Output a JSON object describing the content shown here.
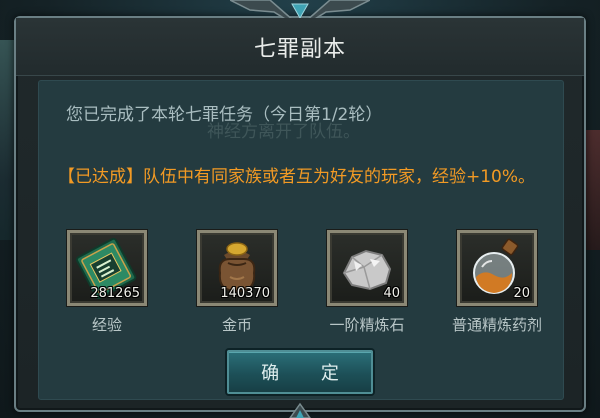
{
  "dialog": {
    "title": "七罪副本",
    "message": "您已完成了本轮七罪任务（今日第1/2轮）",
    "ghost_text": "神经方离开了队伍。",
    "bonus_text": "【已达成】队伍中有同家族或者互为好友的玩家，经验+10%。",
    "confirm_label": "确 定"
  },
  "rewards": [
    {
      "icon": "experience-book-icon",
      "count": "281265",
      "label": "经验"
    },
    {
      "icon": "gold-coin-bag-icon",
      "count": "140370",
      "label": "金币"
    },
    {
      "icon": "refining-stone-icon",
      "count": "40",
      "label": "一阶精炼石"
    },
    {
      "icon": "refining-potion-icon",
      "count": "20",
      "label": "普通精炼药剂"
    }
  ],
  "colors": {
    "accent_orange": "#f29a24",
    "button_teal": "#1d5058",
    "panel_bg": "#243b40"
  }
}
